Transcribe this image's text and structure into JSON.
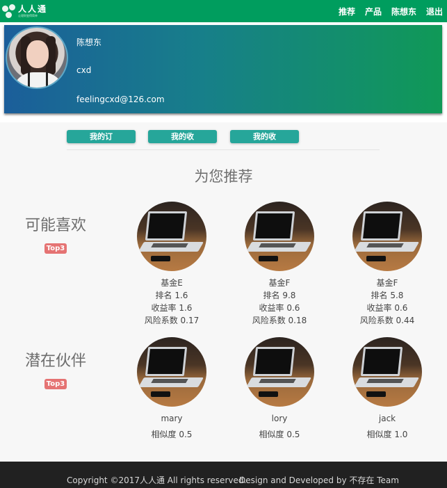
{
  "nav": {
    "logo_name": "人人通",
    "logo_slogan": "让理财变得简单",
    "links": [
      "推荐",
      "产品",
      "陈想东",
      "退出"
    ]
  },
  "profile": {
    "name": "陈想东",
    "username": "cxd",
    "email": "feelingcxd@126.com"
  },
  "tabs": [
    "我的订",
    "我的收",
    "我的收"
  ],
  "section_title": "为您推荐",
  "rows": [
    {
      "label": "可能喜欢",
      "badge": "Top3",
      "items": [
        {
          "name": "基金E",
          "line1": "排名 1.6",
          "line2": "收益率 1.6",
          "line3": "风险系数 0.17"
        },
        {
          "name": "基金F",
          "line1": "排名 9.8",
          "line2": "收益率 0.6",
          "line3": "风险系数 0.18"
        },
        {
          "name": "基金F",
          "line1": "排名 5.8",
          "line2": "收益率 0.6",
          "line3": "风险系数 0.44"
        }
      ]
    },
    {
      "label": "潜在伙伴",
      "badge": "Top3",
      "items": [
        {
          "name": "mary",
          "line1": "相似度 0.5"
        },
        {
          "name": "lory",
          "line1": "相似度 0.5"
        },
        {
          "name": "jack",
          "line1": "相似度 1.0"
        }
      ]
    }
  ],
  "footer": {
    "copyright": "Copyright ©2017人人通 All rights reserved.",
    "credit": "Design and Developed by 不存在 Team"
  },
  "colors": {
    "navbar": "#009d5e",
    "tab": "#26a69a",
    "badge": "#e57373",
    "footer": "#212121"
  }
}
